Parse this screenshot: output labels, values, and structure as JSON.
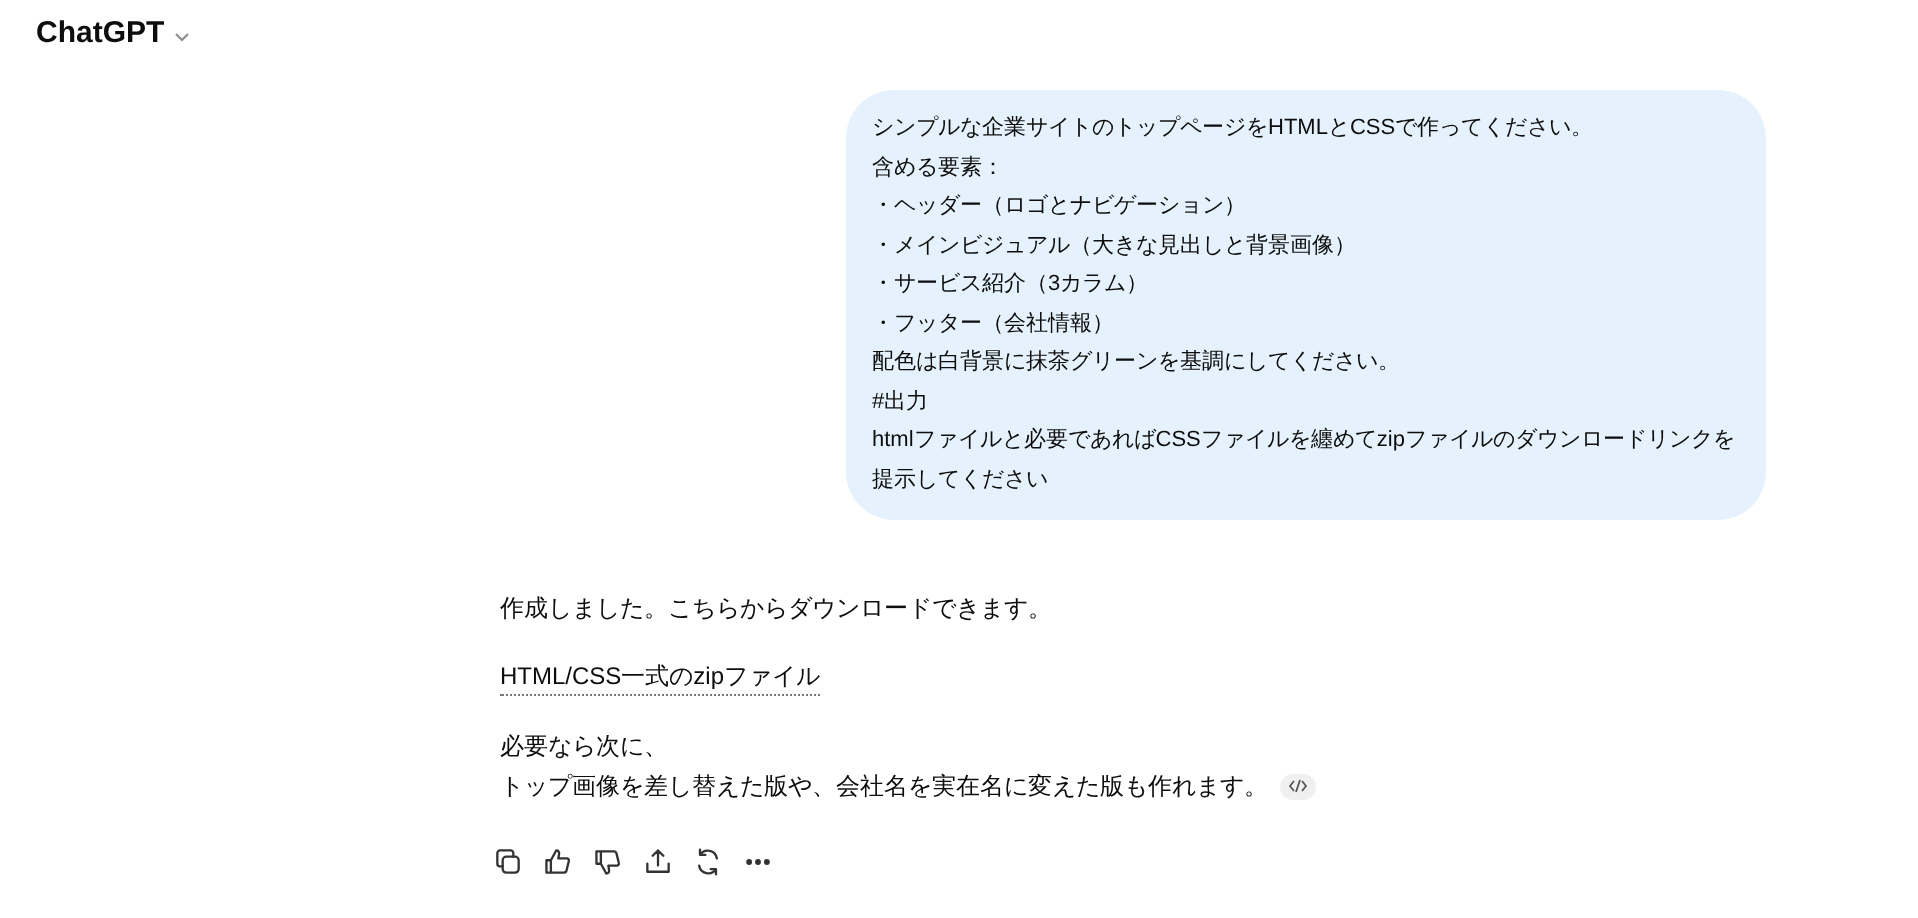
{
  "header": {
    "title": "ChatGPT"
  },
  "user_message": {
    "lines": [
      "シンプルな企業サイトのトップページをHTMLとCSSで作ってください。",
      "含める要素：",
      "・ヘッダー（ロゴとナビゲーション）",
      "・メインビジュアル（大きな見出しと背景画像）",
      "・サービス紹介（3カラム）",
      "・フッター（会社情報）",
      "配色は白背景に抹茶グリーンを基調にしてください。",
      "#出力",
      "htmlファイルと必要であればCSSファイルを纏めてzipファイルのダウンロードリンクを",
      "提示してください"
    ]
  },
  "assistant_message": {
    "paragraphs": [
      {
        "kind": "text",
        "lines": [
          "作成しました。こちらからダウンロードできます。"
        ]
      },
      {
        "kind": "link",
        "lines": [
          "HTML/CSS一式のzipファイル"
        ]
      },
      {
        "kind": "text",
        "lines": [
          "必要なら次に、",
          "トップ画像を差し替えた版や、会社名を実在名に変えた版も作れます。"
        ],
        "code_badge": true
      }
    ]
  }
}
